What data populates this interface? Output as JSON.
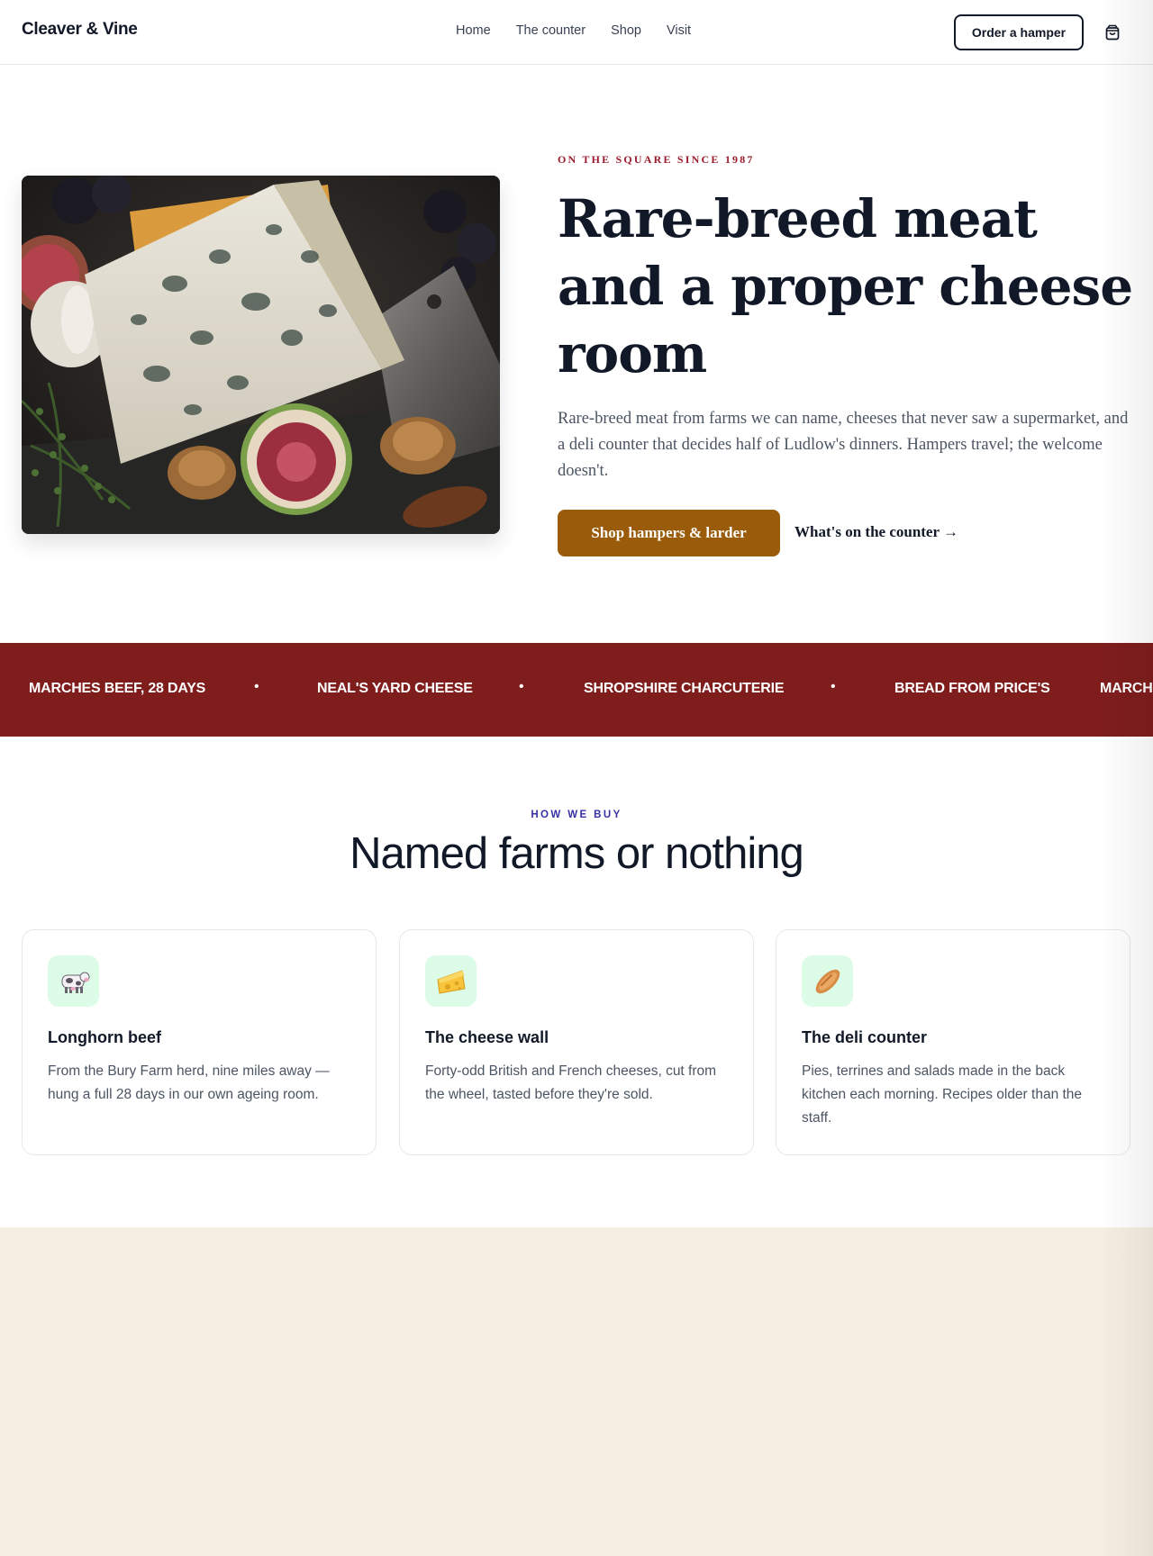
{
  "header": {
    "logo": "Cleaver & Vine",
    "nav": [
      "Home",
      "The counter",
      "Shop",
      "Visit"
    ],
    "cta": "Order a hamper",
    "cart_icon": "shopping-bag-icon"
  },
  "hero": {
    "eyebrow": "ON THE SQUARE SINCE 1987",
    "title": "Rare-breed meat and a proper cheese room",
    "lead": "Rare-breed meat from farms we can name, cheeses that never saw a supermarket, and a deli counter that decides half of Ludlow's dinners. Hampers travel; the welcome doesn't.",
    "primary_cta": "Shop hampers & larder",
    "secondary_cta": "What's on the counter →"
  },
  "marquee": {
    "items": [
      "MARCHES BEEF, 28 DAYS",
      "NEAL'S YARD CHEESE",
      "SHROPSHIRE CHARCUTERIE",
      "BREAD FROM PRICE'S",
      "MARCH"
    ],
    "separator": "•"
  },
  "section": {
    "kicker": "HOW WE BUY",
    "title": "Named farms or nothing"
  },
  "cards": [
    {
      "icon": "cow-icon",
      "emoji": "🐄",
      "title": "Longhorn beef",
      "body": "From the Bury Farm herd, nine miles away — hung a full 28 days in our own ageing room."
    },
    {
      "icon": "cheese-icon",
      "emoji": "🧀",
      "title": "The cheese wall",
      "body": "Forty-odd British and French cheeses, cut from the wheel, tasted before they're sold."
    },
    {
      "icon": "bread-icon",
      "emoji": "🥖",
      "title": "The deli counter",
      "body": "Pies, terrines and salads made in the back kitchen each morning. Recipes older than the staff."
    }
  ],
  "colors": {
    "accent_brown": "#9a5c0a",
    "marquee_red": "#7f1d1d",
    "eyebrow_red": "#9b1c2c",
    "kicker_indigo": "#3730a3",
    "icon_bg_green": "#dcfce7",
    "cream": "#f6eee2"
  }
}
